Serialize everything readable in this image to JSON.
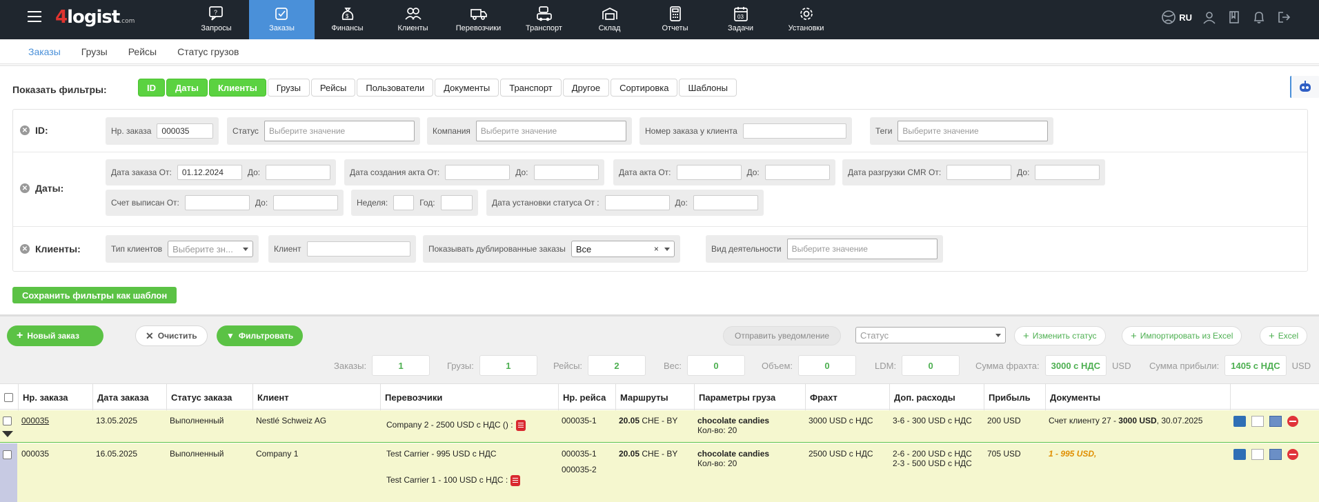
{
  "app": {
    "logo_main": "logist",
    "logo_four": "4",
    "logo_suffix": ".com",
    "lang": "RU"
  },
  "nav": [
    {
      "label": "Запросы",
      "icon": "requests-icon"
    },
    {
      "label": "Заказы",
      "icon": "orders-icon",
      "active": true
    },
    {
      "label": "Финансы",
      "icon": "finance-icon"
    },
    {
      "label": "Клиенты",
      "icon": "clients-icon"
    },
    {
      "label": "Перевозчики",
      "icon": "truck-icon"
    },
    {
      "label": "Транспорт",
      "icon": "transport-icon"
    },
    {
      "label": "Склад",
      "icon": "warehouse-icon"
    },
    {
      "label": "Отчеты",
      "icon": "calculator-icon"
    },
    {
      "label": "Задачи",
      "icon": "calendar-icon"
    },
    {
      "label": "Установки",
      "icon": "gear-icon"
    }
  ],
  "subnav": [
    "Заказы",
    "Грузы",
    "Рейсы",
    "Статус грузов"
  ],
  "filters": {
    "show_label": "Показать фильтры:",
    "chips": [
      {
        "label": "ID",
        "on": true
      },
      {
        "label": "Даты",
        "on": true
      },
      {
        "label": "Клиенты",
        "on": true
      },
      {
        "label": "Грузы"
      },
      {
        "label": "Рейсы"
      },
      {
        "label": "Пользователи"
      },
      {
        "label": "Документы"
      },
      {
        "label": "Транспорт"
      },
      {
        "label": "Другое"
      },
      {
        "label": "Сортировка"
      },
      {
        "label": "Шаблоны"
      }
    ],
    "id_row": {
      "label": "ID:",
      "order_no_label": "Нр. заказа",
      "order_no_value": "000035",
      "status_label": "Статус",
      "status_ph": "Выберите значение",
      "company_label": "Компания",
      "company_ph": "Выберите значение",
      "client_order_label": "Номер заказа у клиента",
      "tags_label": "Теги",
      "tags_ph": "Выберите значение"
    },
    "dates_row": {
      "label": "Даты:",
      "order_date_from": "Дата заказа От:",
      "order_date_value": "01.12.2024",
      "to": "До:",
      "act_created_from": "Дата создания акта От:",
      "act_date_from": "Дата акта От:",
      "cmr_from": "Дата разгрузки CMR От:",
      "invoice_from": "Счет выписан От:",
      "week": "Неделя:",
      "year": "Год:",
      "status_set_from": "Дата установки статуса От :"
    },
    "clients_row": {
      "label": "Клиенты:",
      "type_label": "Тип клиентов",
      "type_ph": "Выберите зн...",
      "client_label": "Клиент",
      "dup_label": "Показывать дублированные заказы",
      "dup_value": "Все",
      "activity_label": "Вид деятельности",
      "activity_ph": "Выберите значение"
    },
    "save_template": "Сохранить фильтры как шаблон"
  },
  "toolbar": {
    "new_order": "Новый заказ",
    "clear": "Очистить",
    "filter": "Фильтровать",
    "notify": "Отправить уведомление",
    "status_ph": "Статус",
    "change_status": "Изменить статус",
    "import_excel": "Импортировать из Excel",
    "excel": "Excel"
  },
  "stats": [
    {
      "label": "Заказы:",
      "value": "1"
    },
    {
      "label": "Грузы:",
      "value": "1"
    },
    {
      "label": "Рейсы:",
      "value": "2"
    },
    {
      "label": "Вес:",
      "value": "0"
    },
    {
      "label": "Объем:",
      "value": "0"
    },
    {
      "label": "LDM:",
      "value": "0"
    },
    {
      "label": "Сумма фрахта:",
      "value": "3000 с НДС",
      "unit": "USD"
    },
    {
      "label": "Сумма прибыли:",
      "value": "1405 с НДС",
      "unit": "USD"
    }
  ],
  "columns": [
    "Нр. заказа",
    "Дата заказа",
    "Статус заказа",
    "Клиент",
    "Перевозчики",
    "Нр. рейса",
    "Маршруты",
    "Параметры груза",
    "Фрахт",
    "Доп. расходы",
    "Прибыль",
    "Документы"
  ],
  "rows": [
    {
      "order_no": "000035",
      "date": "13.05.2025",
      "status": "Выполненный",
      "client": "Nestlé Schweiz AG",
      "carriers": [
        {
          "name": "Company 2",
          "text": "- 2500 USD с НДС () :"
        }
      ],
      "trips": [
        "000035-1"
      ],
      "route_bold": "20.05",
      "route": "CHE - BY",
      "cargo_name": "chocolate candies",
      "cargo_qty": "Кол-во: 20",
      "freight": "3000 USD с НДС",
      "extra": [
        "3-6 - 300 USD с НДС"
      ],
      "profit": "200 USD",
      "doc_prefix": "Счет клиенту",
      "doc_no": "27",
      "doc_sum": "3000 USD",
      "doc_date": ", 30.07.2025"
    },
    {
      "order_no": "000035",
      "date": "16.05.2025",
      "status": "Выполненный",
      "client": "Company 1",
      "carriers": [
        {
          "name": "Test Carrier",
          "text": "- 995 USD с НДС"
        },
        {
          "name": "Test Carrier 1",
          "text": "- 100 USD с НДС :"
        }
      ],
      "trips": [
        "000035-1",
        "000035-2"
      ],
      "route_bold": "20.05",
      "route": "CHE - BY",
      "cargo_name": "chocolate candies",
      "cargo_qty": "Кол-во: 20",
      "freight": "2500 USD с НДС",
      "extra": [
        "2-6 - 200 USD с НДС",
        "2-3 - 500 USD с НДС"
      ],
      "profit": "705 USD",
      "doc_italic": "1 - 995 USD,"
    }
  ],
  "colors": {
    "accent": "#4a90d9",
    "green": "#5bc245",
    "topbar": "#1f262e",
    "row_bg": "#f5f7cf"
  }
}
